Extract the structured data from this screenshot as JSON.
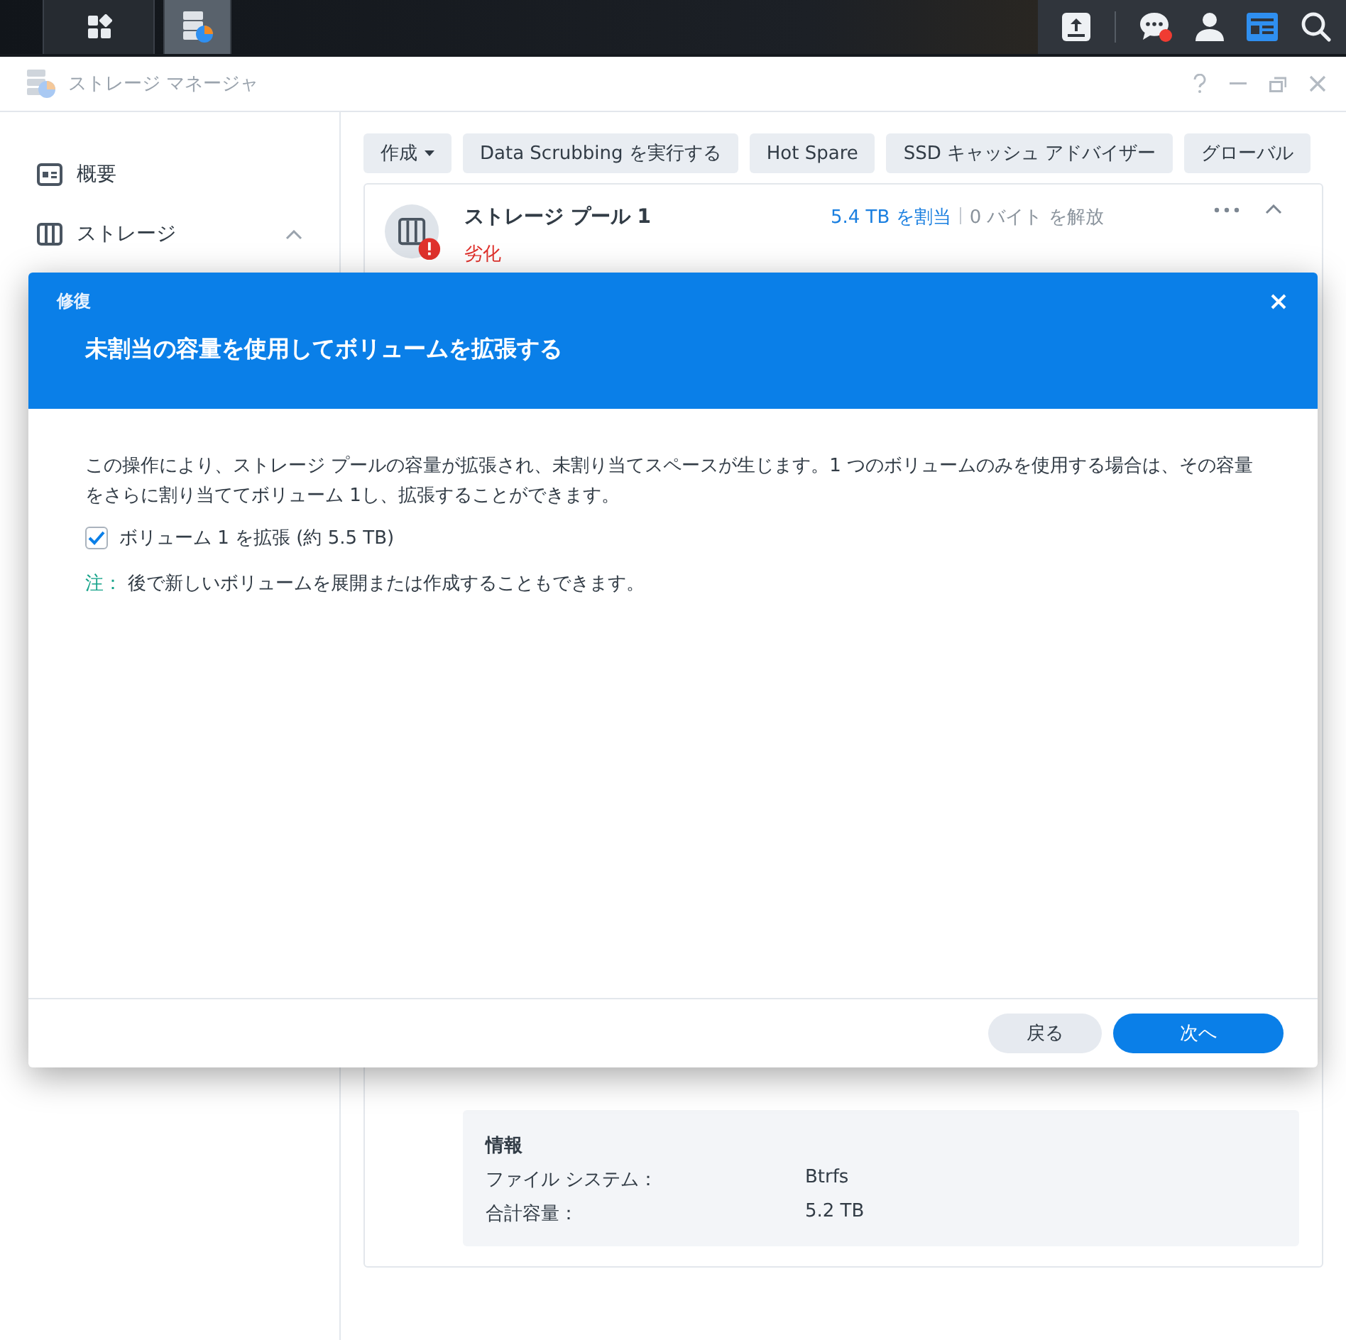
{
  "window": {
    "title": "ストレージ マネージャ"
  },
  "sidebar": {
    "items": [
      {
        "label": "概要",
        "kind": "overview",
        "selected": false
      },
      {
        "label": "ストレージ",
        "kind": "storage",
        "selected": false,
        "expanded": true
      }
    ]
  },
  "toolbar": [
    {
      "label": "作成",
      "dropdown": true
    },
    {
      "label": "Data Scrubbing を実行する",
      "dropdown": false
    },
    {
      "label": "Hot Spare",
      "dropdown": false
    },
    {
      "label": "SSD キャッシュ アドバイザー",
      "dropdown": false
    },
    {
      "label": "グローバル",
      "dropdown": false
    }
  ],
  "pool": {
    "name": "ストレージ プール 1",
    "status": "劣化",
    "allocated": "5.4 TB を割当",
    "free": "0 バイト を解放"
  },
  "info": {
    "title": "情報",
    "rows": [
      {
        "label": "ファイル システム：",
        "value": "Btrfs"
      },
      {
        "label": "合計容量：",
        "value": "5.2 TB"
      }
    ]
  },
  "dialog": {
    "title": "修復",
    "heading": "未割当の容量を使用してボリュームを拡張する",
    "text": "この操作により、ストレージ プールの容量が拡張され、未割り当てスペースが生じます。1 つのボリュームのみを使用する場合は、その容量をさらに割り当ててボリューム 1し、拡張することができます。",
    "checkbox": {
      "label": "ボリューム 1 を拡張 (約 5.5 TB)",
      "checked": true
    },
    "note": {
      "label": "注：",
      "text": "後で新しいボリュームを展開または作成することもできます。"
    },
    "buttons": [
      {
        "label": "戻る",
        "kind": "secondary"
      },
      {
        "label": "次へ",
        "kind": "primary"
      }
    ]
  }
}
